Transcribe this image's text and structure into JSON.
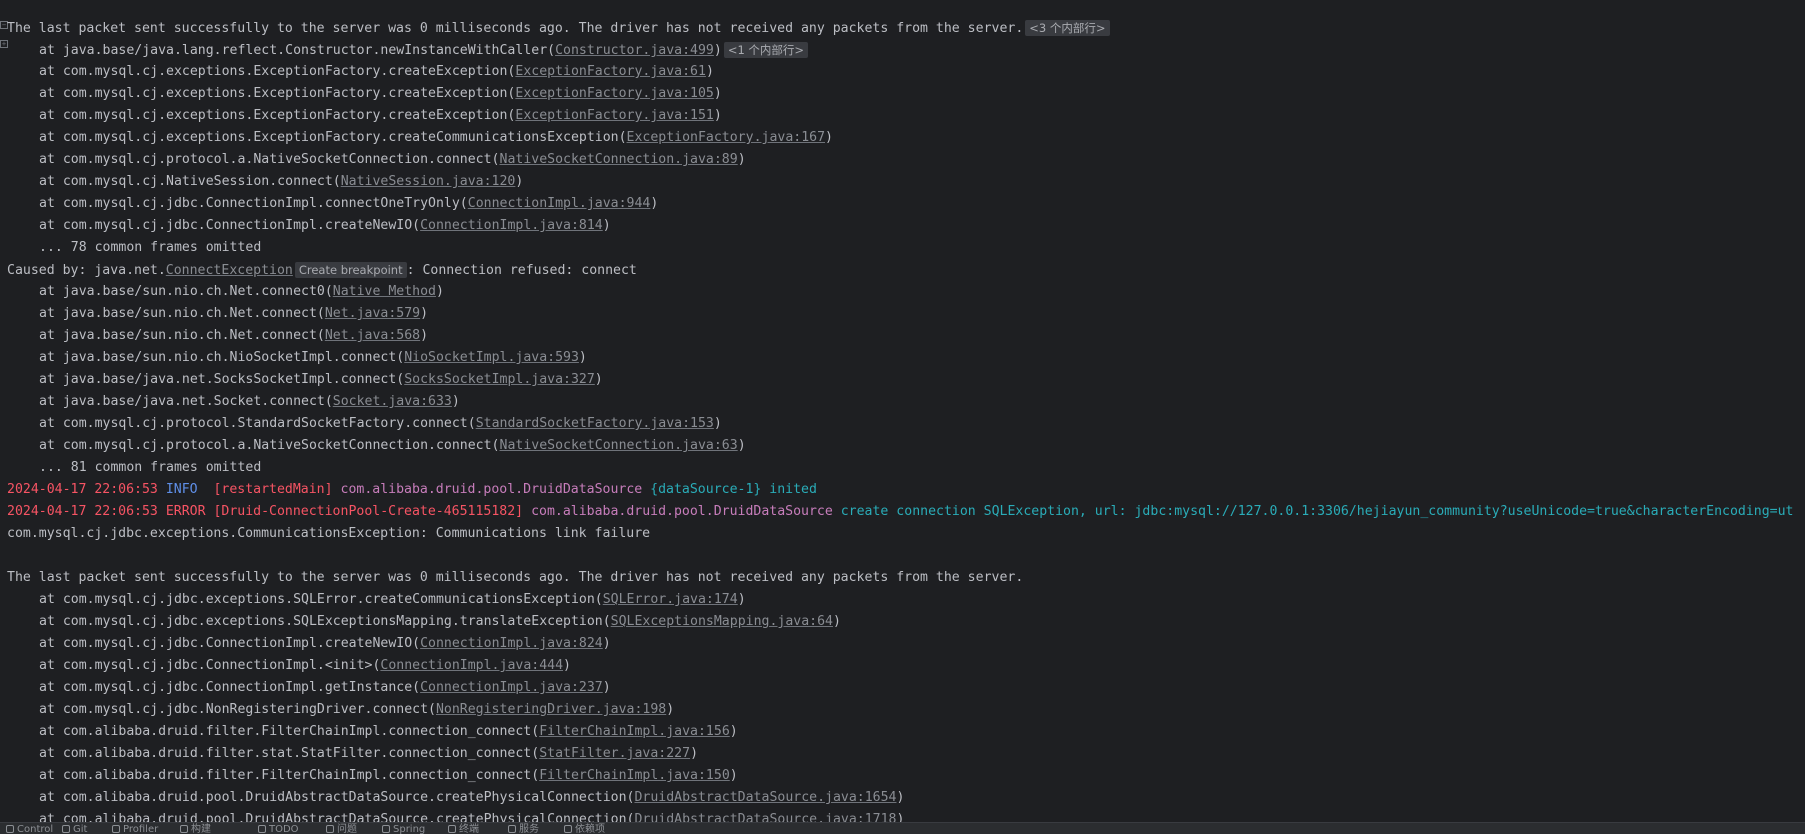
{
  "console": {
    "line0": {
      "text": "The last packet sent successfully to the server was 0 milliseconds ago. The driver has not received any packets from the server.",
      "hint": "<3 个内部行>"
    },
    "line1": {
      "prefix": "at java.base/java.lang.reflect.Constructor.newInstanceWithCaller(",
      "link": "Constructor.java:499",
      "suffix": ")",
      "hint": "<1 个内部行>"
    },
    "frames_a": [
      {
        "prefix": "at com.mysql.cj.exceptions.ExceptionFactory.createException(",
        "link": "ExceptionFactory.java:61",
        "suffix": ")"
      },
      {
        "prefix": "at com.mysql.cj.exceptions.ExceptionFactory.createException(",
        "link": "ExceptionFactory.java:105",
        "suffix": ")"
      },
      {
        "prefix": "at com.mysql.cj.exceptions.ExceptionFactory.createException(",
        "link": "ExceptionFactory.java:151",
        "suffix": ")"
      },
      {
        "prefix": "at com.mysql.cj.exceptions.ExceptionFactory.createCommunicationsException(",
        "link": "ExceptionFactory.java:167",
        "suffix": ")"
      },
      {
        "prefix": "at com.mysql.cj.protocol.a.NativeSocketConnection.connect(",
        "link": "NativeSocketConnection.java:89",
        "suffix": ")"
      },
      {
        "prefix": "at com.mysql.cj.NativeSession.connect(",
        "link": "NativeSession.java:120",
        "suffix": ")"
      },
      {
        "prefix": "at com.mysql.cj.jdbc.ConnectionImpl.connectOneTryOnly(",
        "link": "ConnectionImpl.java:944",
        "suffix": ")"
      },
      {
        "prefix": "at com.mysql.cj.jdbc.ConnectionImpl.createNewIO(",
        "link": "ConnectionImpl.java:814",
        "suffix": ")"
      }
    ],
    "omitted_a": "... 78 common frames omitted",
    "caused_by": {
      "prefix": "Caused by: java.net.",
      "link": "ConnectException",
      "hint": "Create breakpoint",
      "suffix": ": Connection refused: connect"
    },
    "frames_b": [
      {
        "prefix": "at java.base/sun.nio.ch.Net.connect0(",
        "link": "Native Method",
        "suffix": ")"
      },
      {
        "prefix": "at java.base/sun.nio.ch.Net.connect(",
        "link": "Net.java:579",
        "suffix": ")"
      },
      {
        "prefix": "at java.base/sun.nio.ch.Net.connect(",
        "link": "Net.java:568",
        "suffix": ")"
      },
      {
        "prefix": "at java.base/sun.nio.ch.NioSocketImpl.connect(",
        "link": "NioSocketImpl.java:593",
        "suffix": ")"
      },
      {
        "prefix": "at java.base/java.net.SocksSocketImpl.connect(",
        "link": "SocksSocketImpl.java:327",
        "suffix": ")"
      },
      {
        "prefix": "at java.base/java.net.Socket.connect(",
        "link": "Socket.java:633",
        "suffix": ")"
      },
      {
        "prefix": "at com.mysql.cj.protocol.StandardSocketFactory.connect(",
        "link": "StandardSocketFactory.java:153",
        "suffix": ")"
      },
      {
        "prefix": "at com.mysql.cj.protocol.a.NativeSocketConnection.connect(",
        "link": "NativeSocketConnection.java:63",
        "suffix": ")"
      }
    ],
    "omitted_b": "... 81 common frames omitted",
    "log_info": {
      "ts": "2024-04-17 22:06:53",
      "level": "INFO ",
      "thread": "[restartedMain]",
      "logger": "com.alibaba.druid.pool.DruidDataSource",
      "message": "{dataSource-1} inited"
    },
    "log_error": {
      "ts": "2024-04-17 22:06:53",
      "level": "ERROR",
      "thread": "[Druid-ConnectionPool-Create-465115182]",
      "logger": "com.alibaba.druid.pool.DruidDataSource",
      "message": "create connection SQLException, url: jdbc:mysql://127.0.0.1:3306/hejiayun_community?useUnicode=true&characterEncoding=ut"
    },
    "exception_line": "com.mysql.cj.jdbc.exceptions.CommunicationsException: Communications link failure",
    "blank": "",
    "packet_line": "The last packet sent successfully to the server was 0 milliseconds ago. The driver has not received any packets from the server.",
    "frames_c": [
      {
        "prefix": "at com.mysql.cj.jdbc.exceptions.SQLError.createCommunicationsException(",
        "link": "SQLError.java:174",
        "suffix": ")"
      },
      {
        "prefix": "at com.mysql.cj.jdbc.exceptions.SQLExceptionsMapping.translateException(",
        "link": "SQLExceptionsMapping.java:64",
        "suffix": ")"
      },
      {
        "prefix": "at com.mysql.cj.jdbc.ConnectionImpl.createNewIO(",
        "link": "ConnectionImpl.java:824",
        "suffix": ")"
      },
      {
        "prefix": "at com.mysql.cj.jdbc.ConnectionImpl.<init>(",
        "link": "ConnectionImpl.java:444",
        "suffix": ")"
      },
      {
        "prefix": "at com.mysql.cj.jdbc.ConnectionImpl.getInstance(",
        "link": "ConnectionImpl.java:237",
        "suffix": ")"
      },
      {
        "prefix": "at com.mysql.cj.jdbc.NonRegisteringDriver.connect(",
        "link": "NonRegisteringDriver.java:198",
        "suffix": ")"
      },
      {
        "prefix": "at com.alibaba.druid.filter.FilterChainImpl.connection_connect(",
        "link": "FilterChainImpl.java:156",
        "suffix": ")"
      },
      {
        "prefix": "at com.alibaba.druid.filter.stat.StatFilter.connection_connect(",
        "link": "StatFilter.java:227",
        "suffix": ")"
      },
      {
        "prefix": "at com.alibaba.druid.filter.FilterChainImpl.connection_connect(",
        "link": "FilterChainImpl.java:150",
        "suffix": ")"
      },
      {
        "prefix": "at com.alibaba.druid.pool.DruidAbstractDataSource.createPhysicalConnection(",
        "link": "DruidAbstractDataSource.java:1654",
        "suffix": ")"
      },
      {
        "prefix": "at com.alibaba.druid.pool.DruidAbstractDataSource.createPhysicalConnection(",
        "link": "DruidAbstractDataSource.java:1718",
        "suffix": ")"
      }
    ]
  },
  "statusbar": {
    "items": [
      "Control",
      "Git",
      "Profiler",
      "构建",
      "TODO",
      "问题",
      "Spring",
      "终端",
      "服务",
      "依赖项"
    ]
  }
}
